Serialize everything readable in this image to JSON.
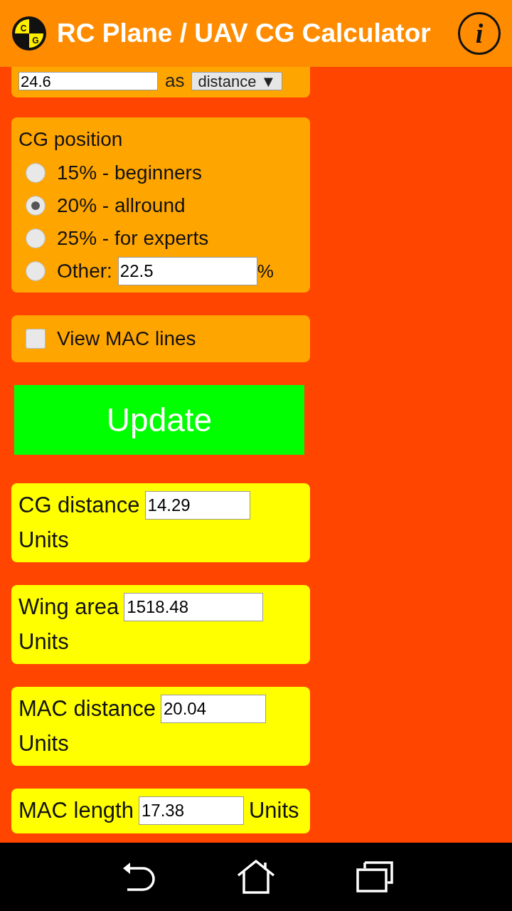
{
  "header": {
    "title": "RC Plane / UAV CG Calculator",
    "logo_letters": [
      "C",
      "G"
    ],
    "info": "i"
  },
  "partial_row": {
    "value": "24.6",
    "label": "as",
    "select": "distance ▼"
  },
  "cg_position": {
    "title": "CG position",
    "options": [
      {
        "label": "15% - beginners",
        "selected": false
      },
      {
        "label": "20% - allround",
        "selected": true
      },
      {
        "label": "25% - for experts",
        "selected": false
      },
      {
        "label": "Other:",
        "selected": false,
        "value": "22.5",
        "suffix": "%"
      }
    ]
  },
  "mac_lines": {
    "label": "View MAC lines",
    "checked": false
  },
  "update_button": "Update",
  "results": [
    {
      "label": "CG distance",
      "value": "14.29",
      "unit": "Units"
    },
    {
      "label": "Wing area",
      "value": "1518.48",
      "unit": "Units"
    },
    {
      "label": "MAC distance",
      "value": "20.04",
      "unit": "Units"
    },
    {
      "label": "MAC length",
      "value": "17.38",
      "unit": "Units"
    }
  ]
}
